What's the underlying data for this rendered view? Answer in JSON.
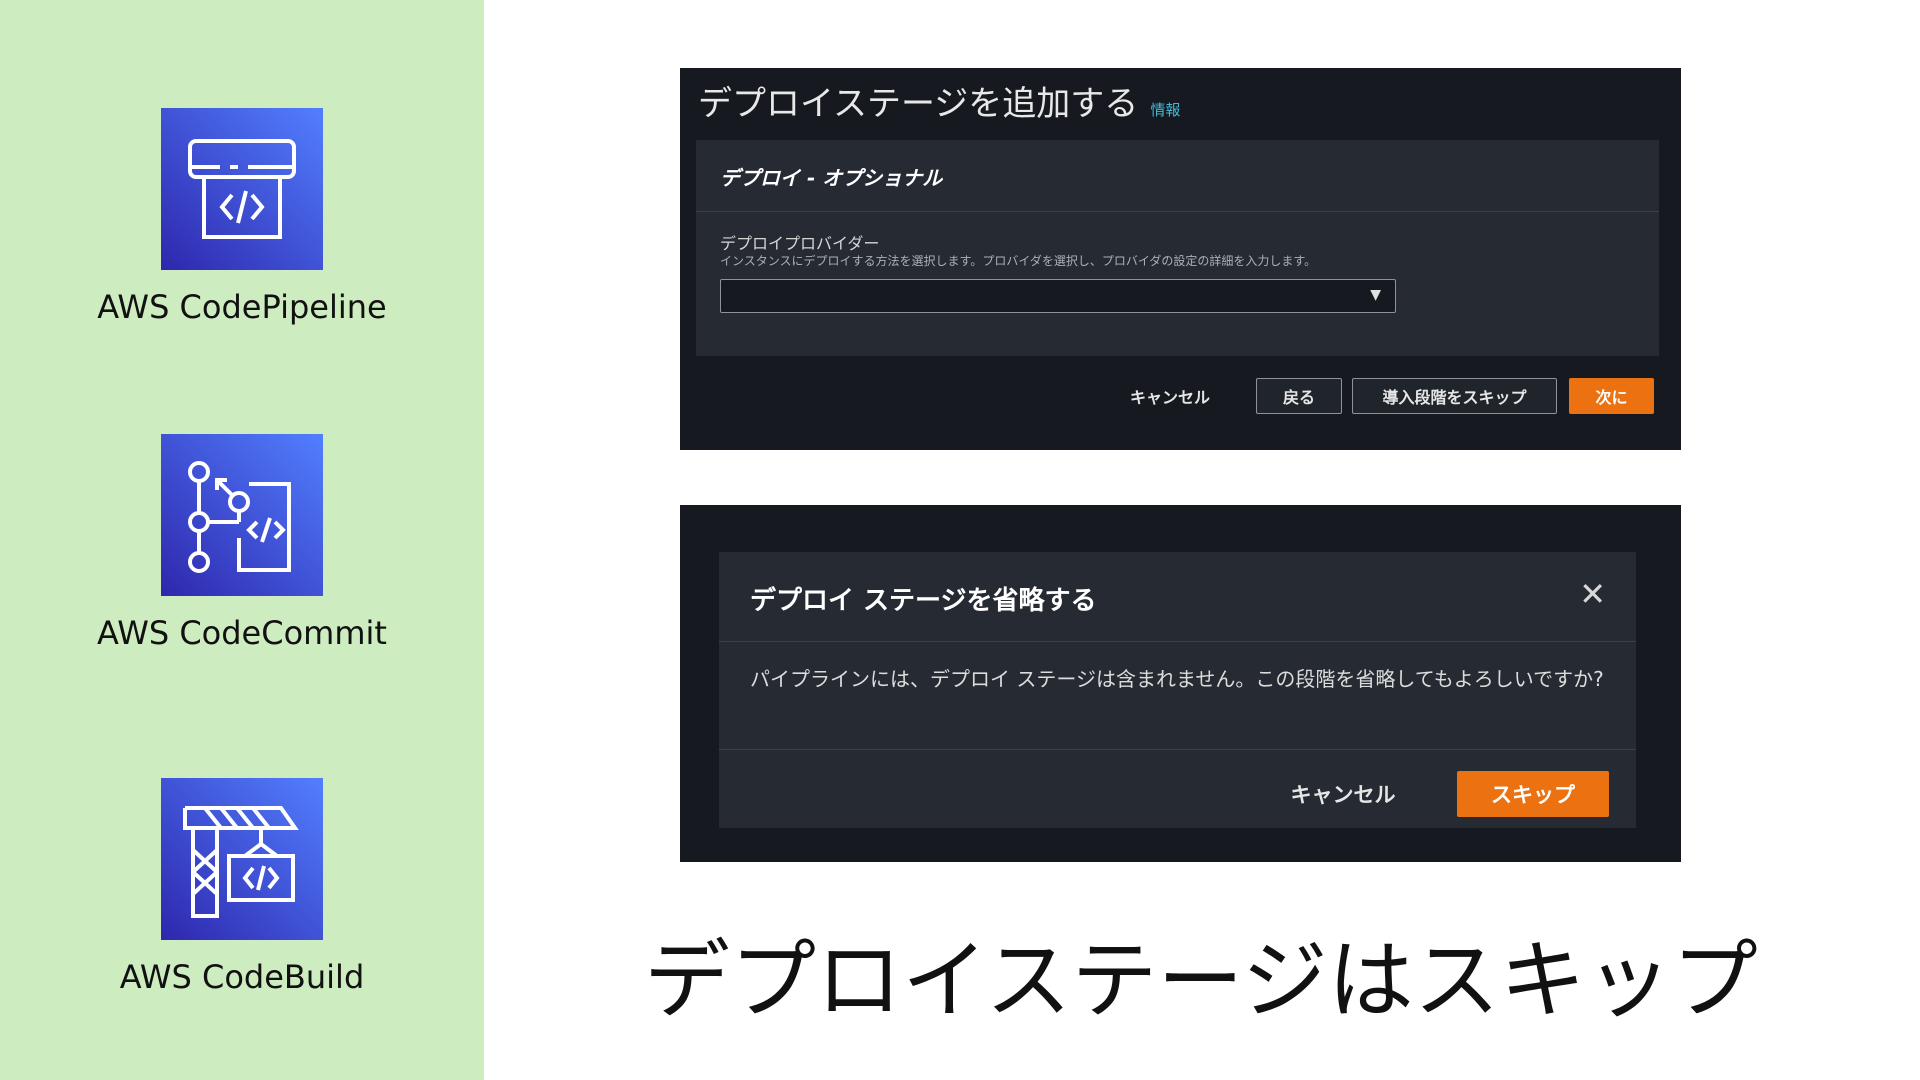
{
  "sidebar": {
    "services": [
      {
        "label": "AWS CodePipeline",
        "icon": "codepipeline-icon"
      },
      {
        "label": "AWS CodeCommit",
        "icon": "codecommit-icon"
      },
      {
        "label": "AWS CodeBuild",
        "icon": "codebuild-icon"
      }
    ]
  },
  "deploy_panel": {
    "title": "デプロイステージを追加する",
    "info_link": "情報",
    "section_title": "デプロイ - オプショナル",
    "provider_label": "デプロイプロバイダー",
    "provider_description": "インスタンスにデプロイする方法を選択します。プロバイダを選択し、プロバイダの設定の詳細を入力します。",
    "provider_value": "",
    "buttons": {
      "cancel": "キャンセル",
      "back": "戻る",
      "skip": "導入段階をスキップ",
      "next": "次に"
    }
  },
  "skip_modal": {
    "title": "デプロイ ステージを省略する",
    "body": "パイプラインには、デプロイ ステージは含まれません。この段階を省略してもよろしいですか?",
    "cancel": "キャンセル",
    "skip": "スキップ"
  },
  "caption": "デプロイステージはスキップ",
  "colors": {
    "sidebar_bg": "#cdecbf",
    "panel_bg": "#16191f",
    "card_bg": "#262b33",
    "primary": "#ec7211",
    "icon_gradient": [
      "#2e27ad",
      "#527fff"
    ]
  }
}
